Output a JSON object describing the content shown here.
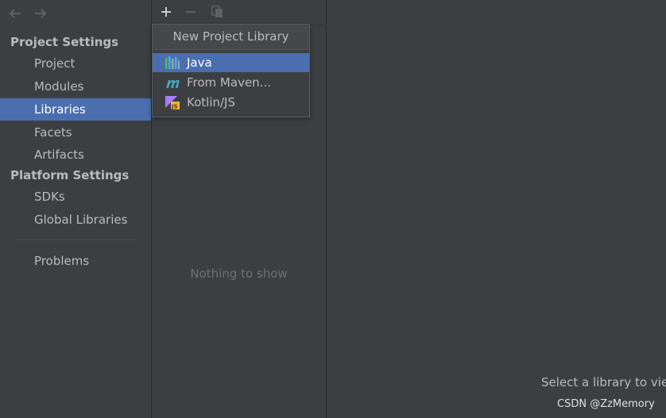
{
  "sidebar": {
    "sections": [
      {
        "title": "Project Settings",
        "items": [
          "Project",
          "Modules",
          "Libraries",
          "Facets",
          "Artifacts"
        ]
      },
      {
        "title": "Platform Settings",
        "items": [
          "SDKs",
          "Global Libraries"
        ]
      }
    ],
    "extra_items": [
      "Problems"
    ],
    "selected": "Libraries"
  },
  "middle": {
    "empty_text": "Nothing to show"
  },
  "popup": {
    "title": "New Project Library",
    "items": [
      {
        "label": "Java",
        "icon": "java-library-icon"
      },
      {
        "label": "From Maven...",
        "icon": "maven-icon"
      },
      {
        "label": "Kotlin/JS",
        "icon": "kotlin-js-icon"
      }
    ],
    "selected": "Java"
  },
  "right": {
    "hint": "Select a library to view or edit its details here"
  },
  "watermark": "CSDN @ZzMemory",
  "colors": {
    "selection": "#4b6eaf",
    "background": "#3c3f41"
  }
}
